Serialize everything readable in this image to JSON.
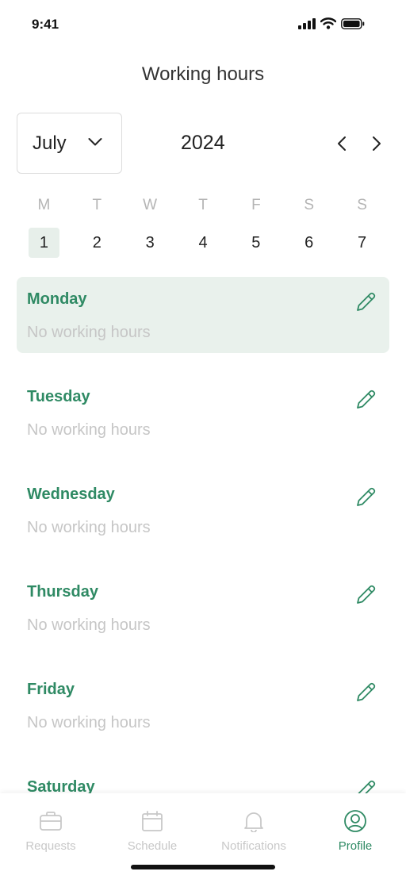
{
  "status_bar": {
    "time": "9:41"
  },
  "header": {
    "title": "Working hours"
  },
  "calendar": {
    "month": "July",
    "year": "2024",
    "weekdays": [
      "M",
      "T",
      "W",
      "T",
      "F",
      "S",
      "S"
    ],
    "dates": [
      "1",
      "2",
      "3",
      "4",
      "5",
      "6",
      "7"
    ],
    "selected_index": 0
  },
  "days": [
    {
      "name": "Monday",
      "status": "No working hours"
    },
    {
      "name": "Tuesday",
      "status": "No working hours"
    },
    {
      "name": "Wednesday",
      "status": "No working hours"
    },
    {
      "name": "Thursday",
      "status": "No working hours"
    },
    {
      "name": "Friday",
      "status": "No working hours"
    },
    {
      "name": "Saturday",
      "status": ""
    }
  ],
  "tab_bar": {
    "tabs": [
      {
        "label": "Requests",
        "icon": "briefcase-icon"
      },
      {
        "label": "Schedule",
        "icon": "calendar-icon"
      },
      {
        "label": "Notifications",
        "icon": "bell-icon"
      },
      {
        "label": "Profile",
        "icon": "profile-icon"
      }
    ],
    "active_index": 3
  },
  "colors": {
    "accent": "#2f8a64",
    "selected_bg": "#e9f1ec",
    "muted": "#c6c6c6"
  }
}
